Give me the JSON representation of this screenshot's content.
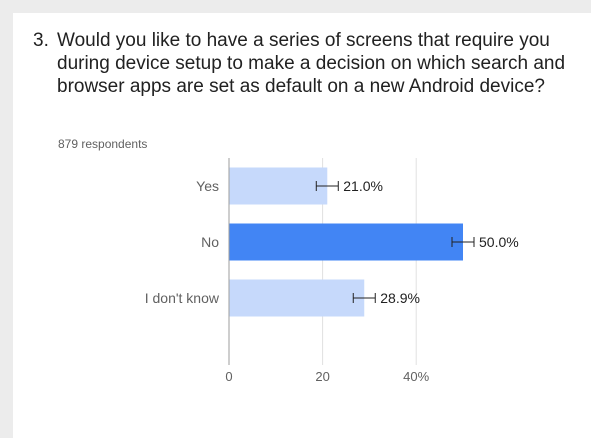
{
  "question": {
    "number": "3.",
    "text": "Would you like to have a series of screens that require you during device setup to make a decision on which search and browser apps are set as default on a new Android device?"
  },
  "respondents": "879 respondents",
  "colors": {
    "bar_light": "#c6d9fb",
    "bar_highlight": "#4285f4",
    "axis": "#9e9e9e",
    "grid": "#e0e0e0",
    "label_text": "#616161",
    "value_text": "#212121"
  },
  "chart_data": {
    "type": "bar",
    "orientation": "horizontal",
    "categories": [
      "Yes",
      "No",
      "I don't know"
    ],
    "values": [
      21.0,
      50.0,
      28.9
    ],
    "value_labels": [
      "21.0%",
      "50.0%",
      "28.9%"
    ],
    "highlighted_index": 1,
    "error_bars": true,
    "xlim": [
      0,
      50
    ],
    "xticks": [
      0,
      20,
      40
    ],
    "xtick_labels": [
      "0",
      "20",
      "40%"
    ],
    "grid": true
  }
}
